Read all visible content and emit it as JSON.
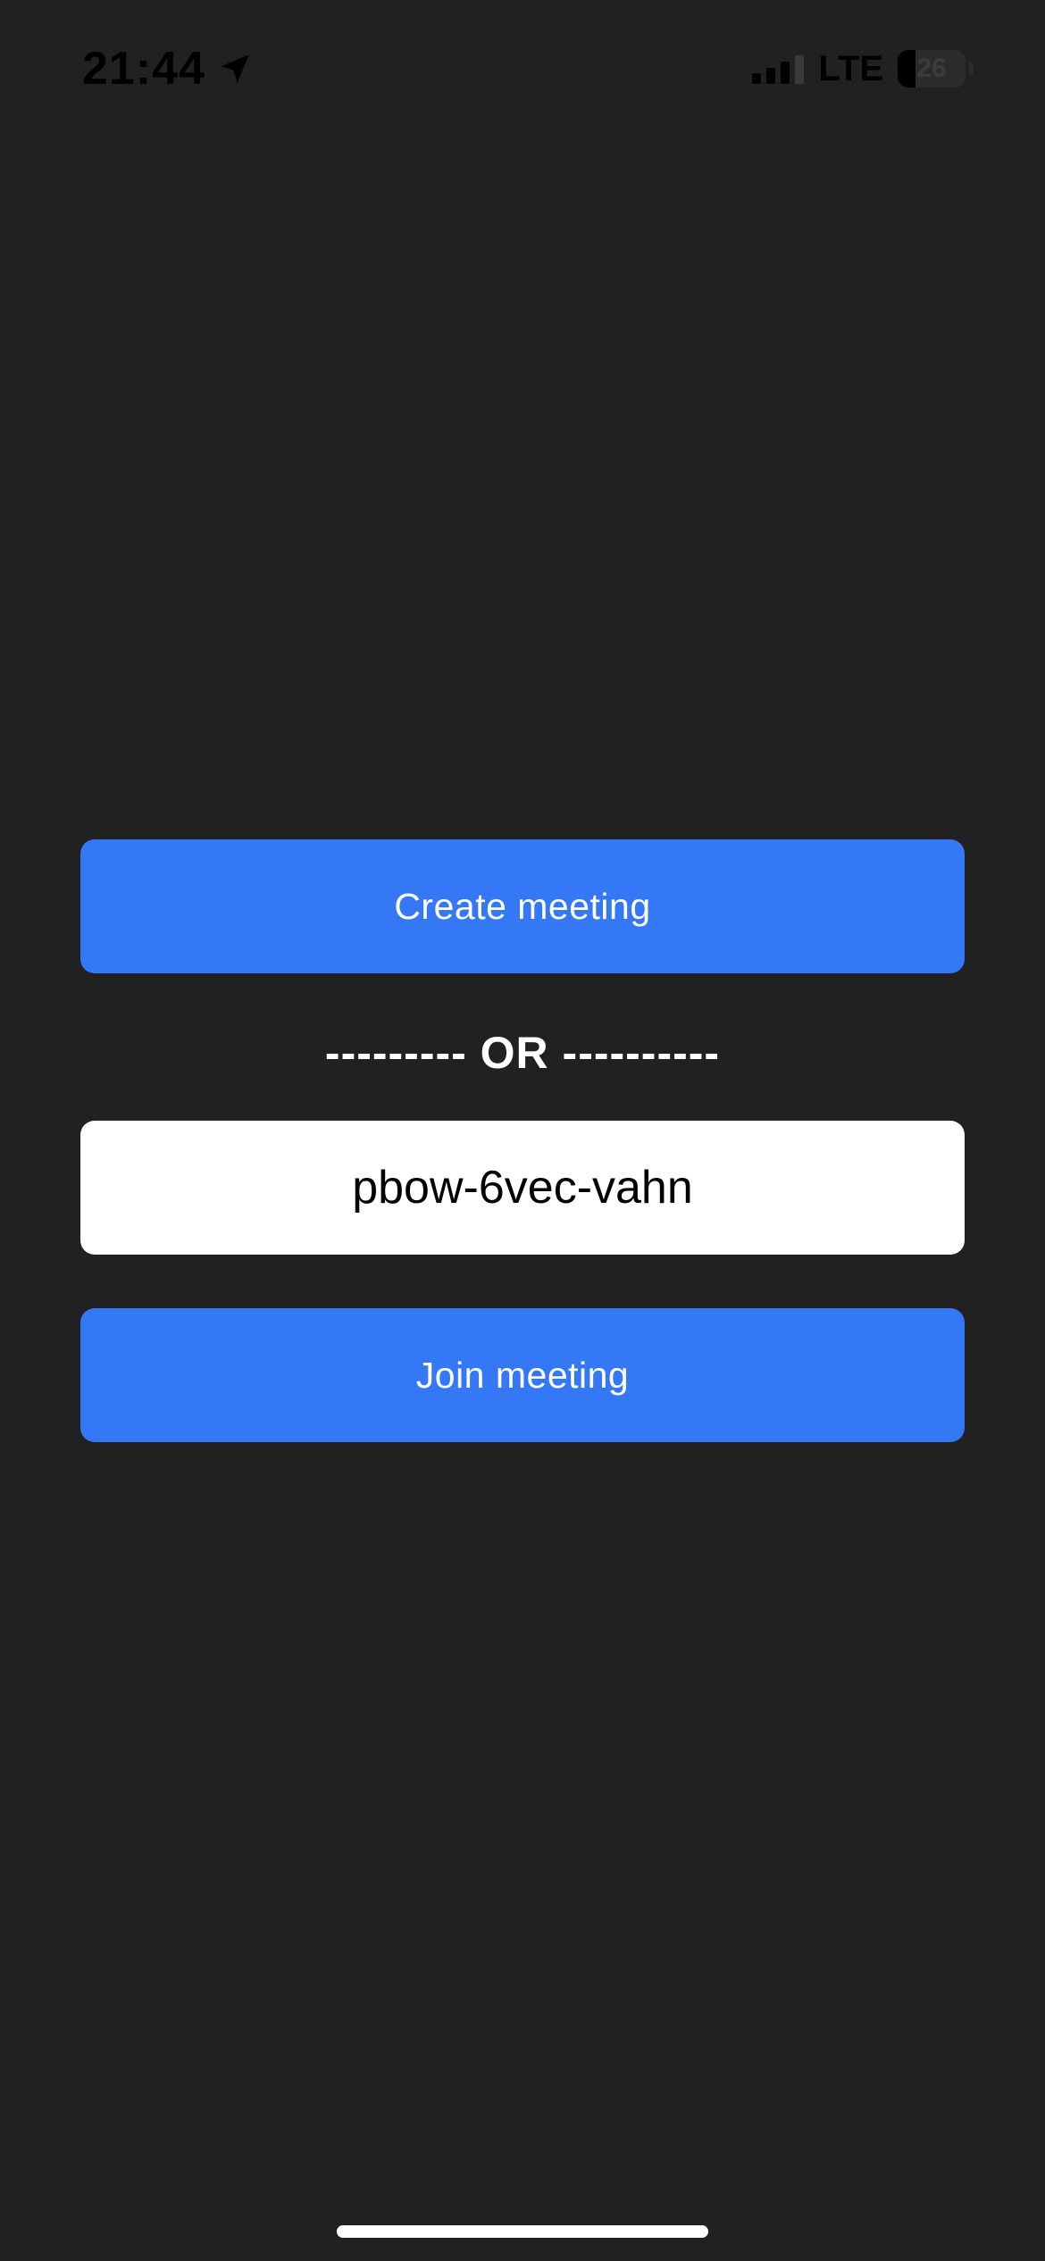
{
  "status_bar": {
    "time": "21:44",
    "network": "LTE",
    "battery_level": "26",
    "icons": {
      "location": "location-arrow-icon",
      "signal": "cellular-signal-icon",
      "battery": "battery-icon"
    }
  },
  "main": {
    "create_button_label": "Create meeting",
    "separator_text": "--------- OR ----------",
    "meeting_code_input": {
      "value": "pbow-6vec-vahn",
      "placeholder": ""
    },
    "join_button_label": "Join meeting"
  },
  "colors": {
    "background": "#212121",
    "accent": "#3478f6",
    "input_background": "#ffffff"
  }
}
